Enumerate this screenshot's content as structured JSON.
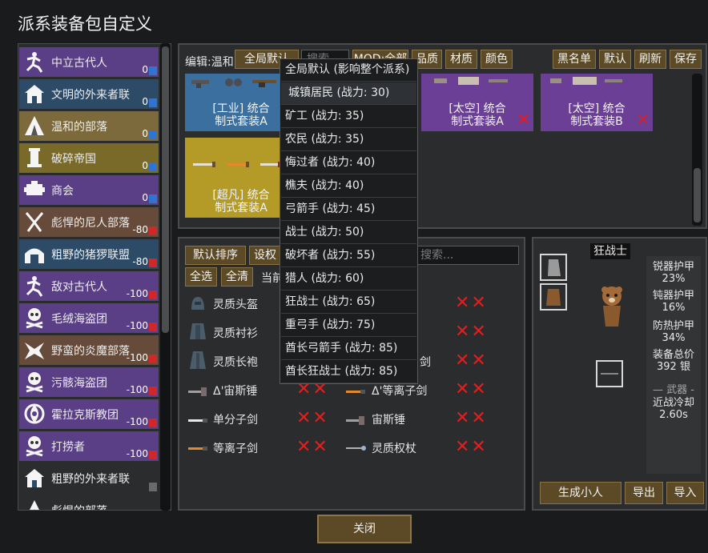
{
  "window": {
    "title": "派系装备包自定义"
  },
  "factions": [
    {
      "name": "中立古代人",
      "goodwill": "0",
      "row_color": "#5a3f86",
      "icon": "ancient-runner-icon",
      "gw_color": "#2f74d0"
    },
    {
      "name": "文明的外来者联",
      "goodwill": "0",
      "row_color": "#2d4b67",
      "icon": "house-icon",
      "gw_color": "#2f74d0"
    },
    {
      "name": "温和的部落",
      "goodwill": "0",
      "row_color": "#7d6a3c",
      "icon": "tent-icon",
      "gw_color": "#2f74d0"
    },
    {
      "name": "破碎帝国",
      "goodwill": "0",
      "row_color": "#7a6a2a",
      "icon": "pillar-icon",
      "gw_color": "#2f74d0"
    },
    {
      "name": "商会",
      "goodwill": "0",
      "row_color": "#5a3f86",
      "icon": "trade-icon",
      "gw_color": "#2f74d0"
    },
    {
      "name": "彪悍的尼人部落",
      "goodwill": "-80",
      "row_color": "#664b3a",
      "icon": "neanderthal-icon",
      "gw_color": "#d02828"
    },
    {
      "name": "粗野的猪猡联盟",
      "goodwill": "-80",
      "row_color": "#2d4b67",
      "icon": "pig-house-icon",
      "gw_color": "#d02828"
    },
    {
      "name": "敌对古代人",
      "goodwill": "-100",
      "row_color": "#5a3f86",
      "icon": "ancient-runner-icon",
      "gw_color": "#d02828"
    },
    {
      "name": "毛绒海盗团",
      "goodwill": "-100",
      "row_color": "#5a3f86",
      "icon": "skull-icon",
      "gw_color": "#d02828"
    },
    {
      "name": "野蛮的炎魔部落",
      "goodwill": "-100",
      "row_color": "#664b3a",
      "icon": "flame-tribe-icon",
      "gw_color": "#d02828"
    },
    {
      "name": "污骸海盗团",
      "goodwill": "-100",
      "row_color": "#5a3f86",
      "icon": "skull-icon",
      "gw_color": "#d02828"
    },
    {
      "name": "霍拉克斯教团",
      "goodwill": "-100",
      "row_color": "#5a3f86",
      "icon": "horax-icon",
      "gw_color": "#d02828"
    },
    {
      "name": "打捞者",
      "goodwill": "-100",
      "row_color": "#5a3f86",
      "icon": "skull-icon",
      "gw_color": "#d02828"
    },
    {
      "name": "粗野的外来者联",
      "goodwill": "",
      "row_color": "#2b2c2e",
      "icon": "house-icon",
      "gw_color": "#6a6a6a"
    },
    {
      "name": "彪悍的部落",
      "goodwill": "",
      "row_color": "#2b2c2e",
      "icon": "tent-icon",
      "gw_color": "#6a6a6a"
    }
  ],
  "editor": {
    "edit_label": "编辑:温和",
    "global_default_button": "全局默认",
    "search_placeholder": "搜索",
    "mod_button": "MOD:全部",
    "quality_button": "品质",
    "material_button": "材质",
    "color_button": "颜色",
    "blacklist_button": "黑名单",
    "default_button": "默认",
    "refresh_button": "刷新",
    "save_button": "保存",
    "kits": [
      {
        "label_line1": "[工业] 统合",
        "label_line2": "制式套装A",
        "color": "#3b6fa0",
        "removable": false
      },
      {
        "label_line1": "[太空] 统合",
        "label_line2": "制式套装A",
        "color": "#6a3f95",
        "removable": true
      },
      {
        "label_line1": "[太空] 统合",
        "label_line2": "制式套装B",
        "color": "#6a3f95",
        "removable": true
      },
      {
        "label_line1": "[超凡] 统合",
        "label_line2": "制式套装A",
        "color": "#b49a26",
        "removable": false
      }
    ]
  },
  "items_panel": {
    "default_sort_button": "默认排序",
    "set_weight_button": "设权",
    "select_all_button": "全选",
    "clear_all_button": "全清",
    "current_label": "当前",
    "search_placeholder": "搜索...",
    "left_items": [
      {
        "name": "灵质头盔",
        "icon": "helmet-icon"
      },
      {
        "name": "灵质衬衫",
        "icon": "shirt-icon"
      },
      {
        "name": "灵质长袍",
        "icon": "robe-icon"
      },
      {
        "name": "Δ'宙斯锤",
        "icon": "hammer-icon"
      },
      {
        "name": "单分子剑",
        "icon": "sword-icon"
      },
      {
        "name": "等离子剑",
        "icon": "plasma-sword-icon"
      }
    ],
    "right_items": [
      {
        "name": "剑",
        "icon": "sword-icon"
      },
      {
        "name": "Δ'等离子剑",
        "icon": "plasma-sword-icon"
      },
      {
        "name": "宙斯锤",
        "icon": "hammer-icon"
      },
      {
        "name": "灵质权杖",
        "icon": "staff-icon"
      }
    ],
    "remove_mark": "✕✕"
  },
  "pawn_panel": {
    "pawn_kind": "狂战士",
    "stats": {
      "sharp_label": "锐器护甲",
      "sharp_value": "23%",
      "blunt_label": "钝器护甲",
      "blunt_value": "16%",
      "heat_label": "防热护甲",
      "heat_value": "34%",
      "total_label": "装备总价",
      "total_value": "392 银",
      "weapon_header": "— 武器 -",
      "cooldown_label": "近战冷却",
      "cooldown_value": "2.60s"
    },
    "generate_button": "生成小人",
    "export_button": "导出",
    "import_button": "导入"
  },
  "dropdown": {
    "items": [
      "全局默认 (影响整个派系)",
      "城镇居民 (战力: 30)",
      "矿工 (战力: 35)",
      "农民 (战力: 35)",
      "悔过者 (战力: 40)",
      "樵夫 (战力: 40)",
      "弓箭手 (战力: 45)",
      "战士 (战力: 50)",
      "破坏者 (战力: 55)",
      "猎人 (战力: 60)",
      "狂战士 (战力: 65)",
      "重弓手 (战力: 75)",
      "酋长弓箭手 (战力: 85)",
      "酋长狂战士 (战力: 85)"
    ],
    "highlighted": 1
  },
  "footer": {
    "close_button": "关闭"
  }
}
